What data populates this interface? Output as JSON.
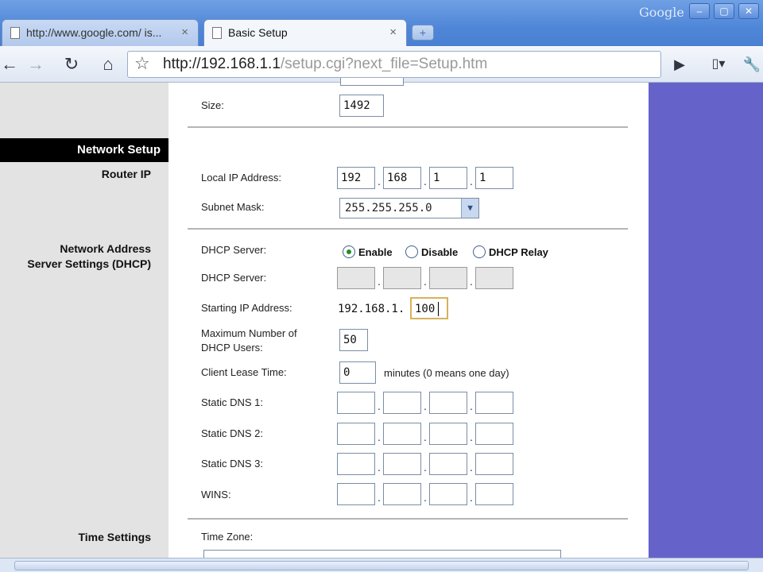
{
  "window": {
    "brand": "Google",
    "minimize": "–",
    "restore": "▢",
    "close": "✕"
  },
  "tabs": [
    {
      "title": "http://www.google.com/ is...",
      "close": "×"
    },
    {
      "title": "Basic Setup",
      "close": "×"
    }
  ],
  "newtab": "+",
  "toolbar": {
    "back": "←",
    "forward": "→",
    "reload": "↻",
    "home": "⌂",
    "star": "☆",
    "url_host": "http://192.168.1.1",
    "url_path": "/setup.cgi?next_file=Setup.htm",
    "go": "▶",
    "page_menu": "▾",
    "tools": "🔧"
  },
  "sidebar": {
    "section": "Network Setup",
    "router_ip": "Router IP",
    "dhcp_line1": "Network Address",
    "dhcp_line2": "Server Settings (DHCP)",
    "time": "Time Settings"
  },
  "mtu": {
    "size_label": "Size:",
    "size_value": "1492"
  },
  "router": {
    "local_ip_label": "Local IP Address:",
    "ip": [
      "192",
      "168",
      "1",
      "1"
    ],
    "subnet_label": "Subnet Mask:",
    "subnet_value": "255.255.255.0"
  },
  "dhcp": {
    "server_label": "DHCP Server:",
    "options": [
      "Enable",
      "Disable",
      "DHCP Relay"
    ],
    "relay_label": "DHCP Server:",
    "start_label": "Starting IP Address:",
    "start_prefix": "192.168.1.",
    "start_value": "100",
    "max_label_1": "Maximum Number of",
    "max_label_2": "DHCP Users:",
    "max_value": "50",
    "lease_label": "Client Lease Time:",
    "lease_value": "0",
    "lease_note": "minutes (0 means one day)",
    "dns1_label": "Static DNS 1:",
    "dns2_label": "Static DNS 2:",
    "dns3_label": "Static DNS 3:",
    "wins_label": "WINS:"
  },
  "time": {
    "zone_label": "Time Zone:"
  },
  "separator": "."
}
